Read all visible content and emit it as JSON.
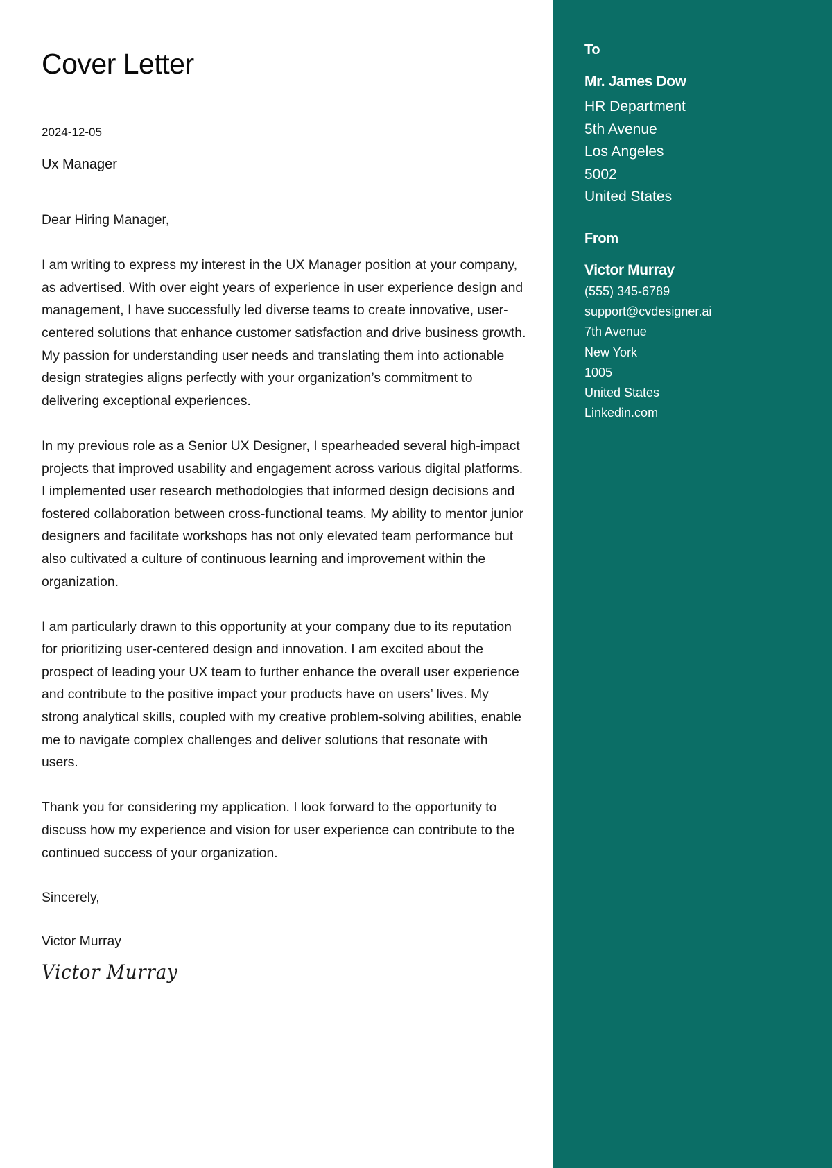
{
  "document": {
    "title": "Cover Letter",
    "date": "2024-12-05",
    "job_title": "Ux Manager",
    "salutation": "Dear Hiring Manager,",
    "paragraphs": [
      "I am writing to express my interest in the UX Manager position at your company, as advertised. With over eight years of experience in user experience design and management, I have successfully led diverse teams to create innovative, user-centered solutions that enhance customer satisfaction and drive business growth. My passion for understanding user needs and translating them into actionable design strategies aligns perfectly with your organization’s commitment to delivering exceptional experiences.",
      "In my previous role as a Senior UX Designer, I spearheaded several high-impact projects that improved usability and engagement across various digital platforms. I implemented user research methodologies that informed design decisions and fostered collaboration between cross-functional teams. My ability to mentor junior designers and facilitate workshops has not only elevated team performance but also cultivated a culture of continuous learning and improvement within the organization.",
      "I am particularly drawn to this opportunity at your company due to its reputation for prioritizing user-centered design and innovation. I am excited about the prospect of leading your UX team to further enhance the overall user experience and contribute to the positive impact your products have on users’ lives. My strong analytical skills, coupled with my creative problem-solving abilities, enable me to navigate complex challenges and deliver solutions that resonate with users.",
      "Thank you for considering my application. I look forward to the opportunity to discuss how my experience and vision for user experience can contribute to the continued success of your organization."
    ],
    "closing": "Sincerely,",
    "sender_name": "Victor Murray",
    "signature": "Victor Murray"
  },
  "sidebar": {
    "accent_color": "#0b6e66",
    "to": {
      "label": "To",
      "name": "Mr. James Dow",
      "lines": [
        "HR Department",
        "5th Avenue",
        "Los Angeles",
        "5002",
        "United States"
      ]
    },
    "from": {
      "label": "From",
      "name": "Victor Murray",
      "phone": "(555) 345-6789",
      "email": "support@cvdesigner.ai",
      "street": "7th Avenue",
      "city": "New York",
      "postal_code": "1005",
      "country": "United States",
      "website": "Linkedin.com"
    }
  }
}
